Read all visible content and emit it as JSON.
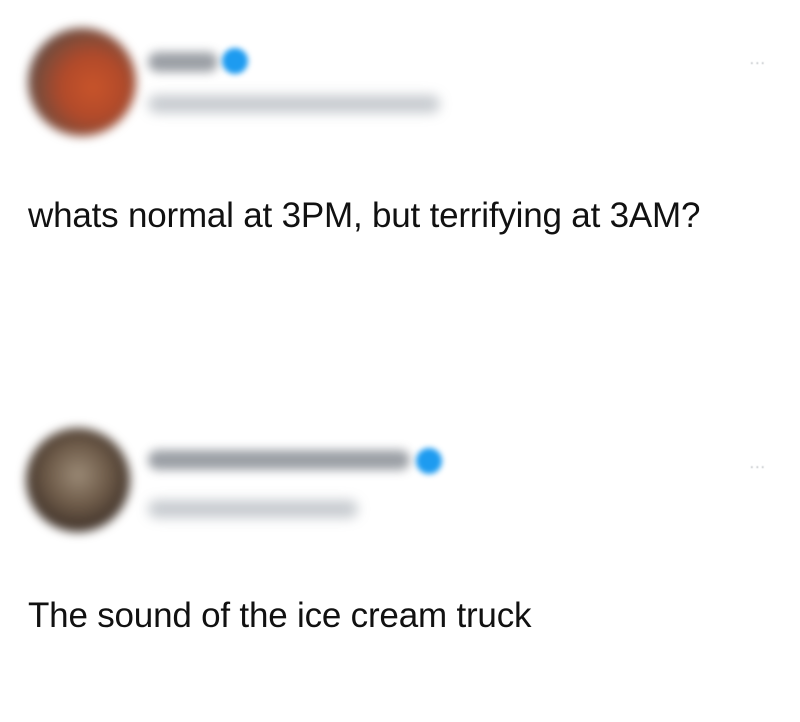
{
  "tweets": [
    {
      "more_label": "...",
      "text": "whats normal at 3PM, but terrifying at 3AM?",
      "author_verified": true
    },
    {
      "more_label": "...",
      "text": "The sound of the ice cream truck",
      "author_verified": true
    }
  ],
  "colors": {
    "verified": "#1d9bf0",
    "text": "#0f1419"
  }
}
